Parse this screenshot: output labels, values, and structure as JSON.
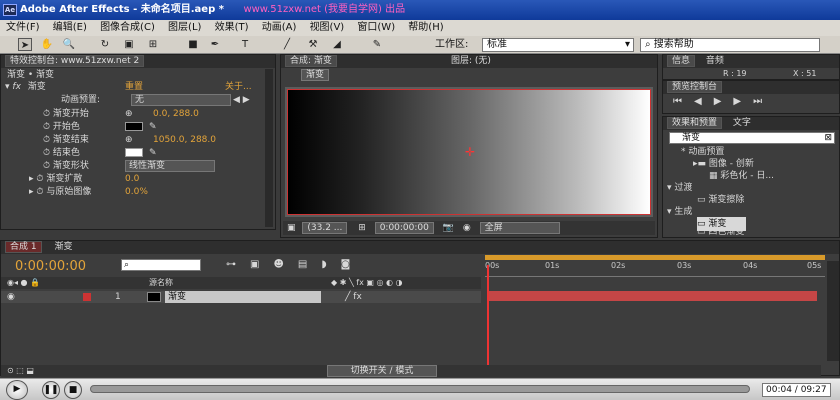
{
  "window": {
    "app_icon": "Ae",
    "title": "Adobe After Effects - 未命名项目.aep *",
    "watermark": "www.51zxw.net (我要自学网) 出品"
  },
  "menu": [
    "文件(F)",
    "编辑(E)",
    "图像合成(C)",
    "图层(L)",
    "效果(T)",
    "动画(A)",
    "视图(V)",
    "窗口(W)",
    "帮助(H)"
  ],
  "toolbar": {
    "workspace_label": "工作区:",
    "workspace_value": "标准",
    "search_placeholder": "搜索帮助"
  },
  "effects_panel": {
    "tab": "特效控制台: www.51zxw.net 2",
    "breadcrumb": "渐变 • 渐变",
    "effect_name": "渐变",
    "reset": "重置",
    "about": "关于...",
    "preset_label": "动画预置:",
    "preset_value": "无",
    "props": [
      {
        "label": "渐变开始",
        "value": "0.0, 288.0"
      },
      {
        "label": "开始色",
        "value": ""
      },
      {
        "label": "渐变结束",
        "value": "1050.0, 288.0"
      },
      {
        "label": "结束色",
        "value": ""
      },
      {
        "label": "渐变形状",
        "value": "线性渐变"
      },
      {
        "label": "渐变扩散",
        "value": "0.0"
      },
      {
        "label": "与原始图像",
        "value": "0.0%"
      }
    ],
    "start_color": "#000000",
    "end_color": "#ffffff"
  },
  "comp_panel": {
    "tab": "合成: 渐变",
    "layer_tab": "图层: (无)",
    "comp_button": "渐变",
    "zoom": "(33.2 ...",
    "timecode": "0:00:00:00",
    "view": "全屏"
  },
  "info_panel": {
    "tab_info": "信息",
    "tab_audio": "音频",
    "r_label": "R : 19",
    "x_label": "X : 51"
  },
  "preview_panel": {
    "tab": "预览控制台"
  },
  "effects_presets": {
    "tab": "效果和预置",
    "tab2": "文字",
    "search_value": "渐变",
    "items": [
      {
        "label": "* 动画预置",
        "indent": 1
      },
      {
        "label": "图像 - 创新",
        "indent": 2
      },
      {
        "label": "彩色化 - 日...",
        "indent": 3
      },
      {
        "label": "过渡",
        "indent": 1
      },
      {
        "label": "渐变擦除",
        "indent": 3
      },
      {
        "label": "生成",
        "indent": 1
      },
      {
        "label": "渐变",
        "indent": 3
      },
      {
        "label": "四色渐变",
        "indent": 3
      }
    ]
  },
  "timeline": {
    "tab1": "合成 1",
    "tab2": "渐变",
    "timecode": "0:00:00:00",
    "source_name_header": "源名称",
    "ruler": [
      "00s",
      "01s",
      "02s",
      "03s",
      "04s",
      "05s"
    ],
    "layer_index": "1",
    "layer_name": "渐变",
    "switch_mode": "切换开关 / 模式",
    "bar_color": "#c54646"
  },
  "player": {
    "time": "00:04 / 09:27",
    "progress": 0.0
  }
}
